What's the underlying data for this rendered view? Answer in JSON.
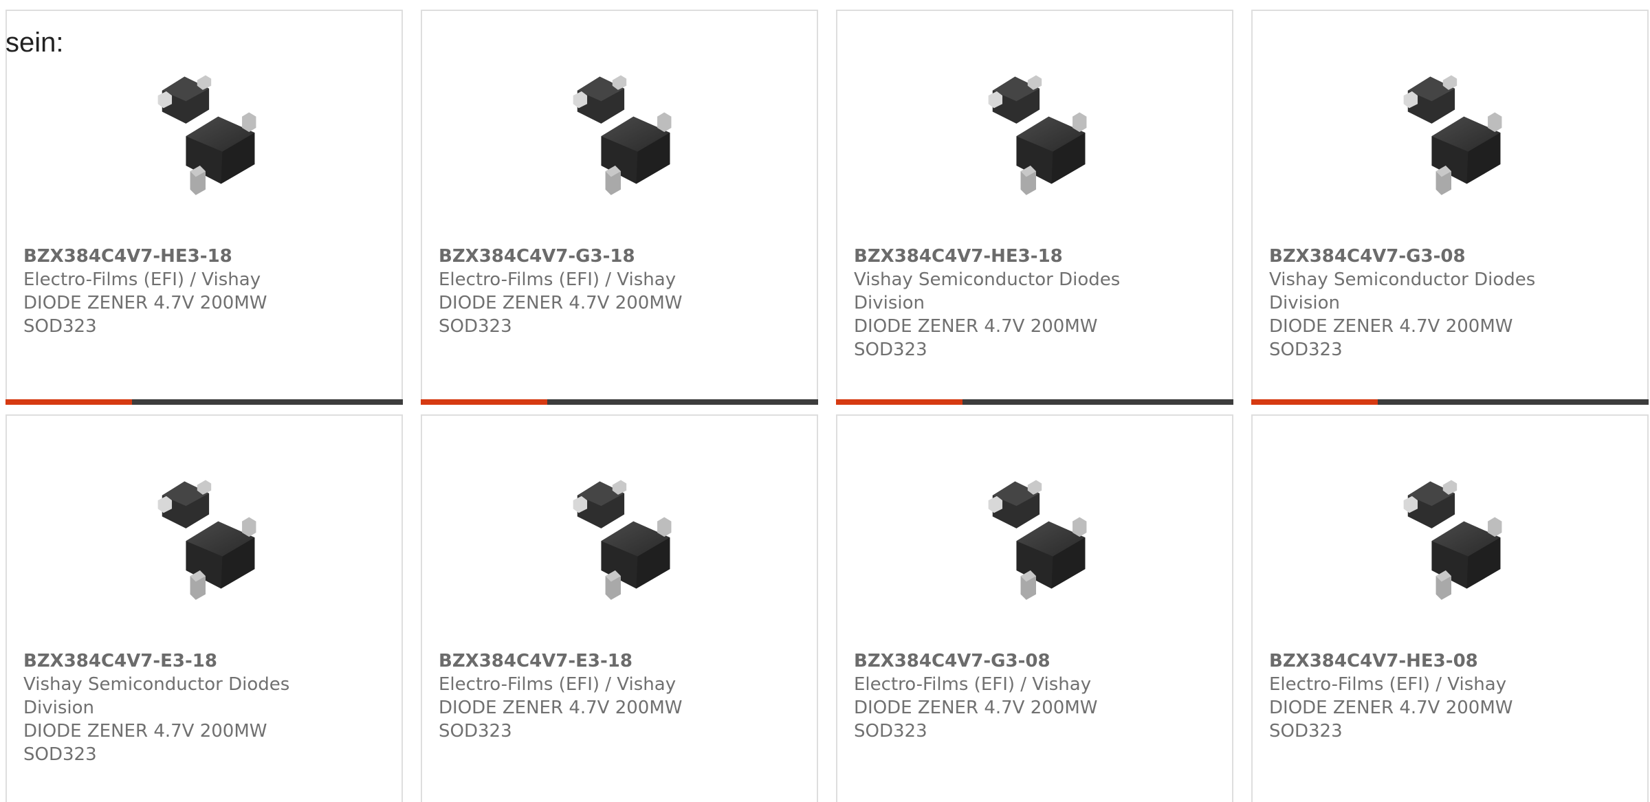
{
  "intro_text": "sein:",
  "colors": {
    "accent": "#d63a12",
    "bar": "#3d3d3d",
    "text": "#707070",
    "border": "#dedede"
  },
  "product_image_icon": "sod323-diode-icon",
  "cards": [
    {
      "part": "BZX384C4V7-HE3-18",
      "manufacturer": "Electro-Films (EFI) / Vishay",
      "description": "DIODE ZENER 4.7V 200MW SOD323"
    },
    {
      "part": "BZX384C4V7-G3-18",
      "manufacturer": "Electro-Films (EFI) / Vishay",
      "description": "DIODE ZENER 4.7V 200MW SOD323"
    },
    {
      "part": "BZX384C4V7-HE3-18",
      "manufacturer": "Vishay Semiconductor Diodes Division",
      "description": "DIODE ZENER 4.7V 200MW SOD323"
    },
    {
      "part": "BZX384C4V7-G3-08",
      "manufacturer": "Vishay Semiconductor Diodes Division",
      "description": "DIODE ZENER 4.7V 200MW SOD323"
    },
    {
      "part": "BZX384C4V7-E3-18",
      "manufacturer": "Vishay Semiconductor Diodes Division",
      "description": "DIODE ZENER 4.7V 200MW SOD323"
    },
    {
      "part": "BZX384C4V7-E3-18",
      "manufacturer": "Electro-Films (EFI) / Vishay",
      "description": "DIODE ZENER 4.7V 200MW SOD323"
    },
    {
      "part": "BZX384C4V7-G3-08",
      "manufacturer": "Electro-Films (EFI) / Vishay",
      "description": "DIODE ZENER 4.7V 200MW SOD323"
    },
    {
      "part": "BZX384C4V7-HE3-08",
      "manufacturer": "Electro-Films (EFI) / Vishay",
      "description": "DIODE ZENER 4.7V 200MW SOD323"
    }
  ]
}
